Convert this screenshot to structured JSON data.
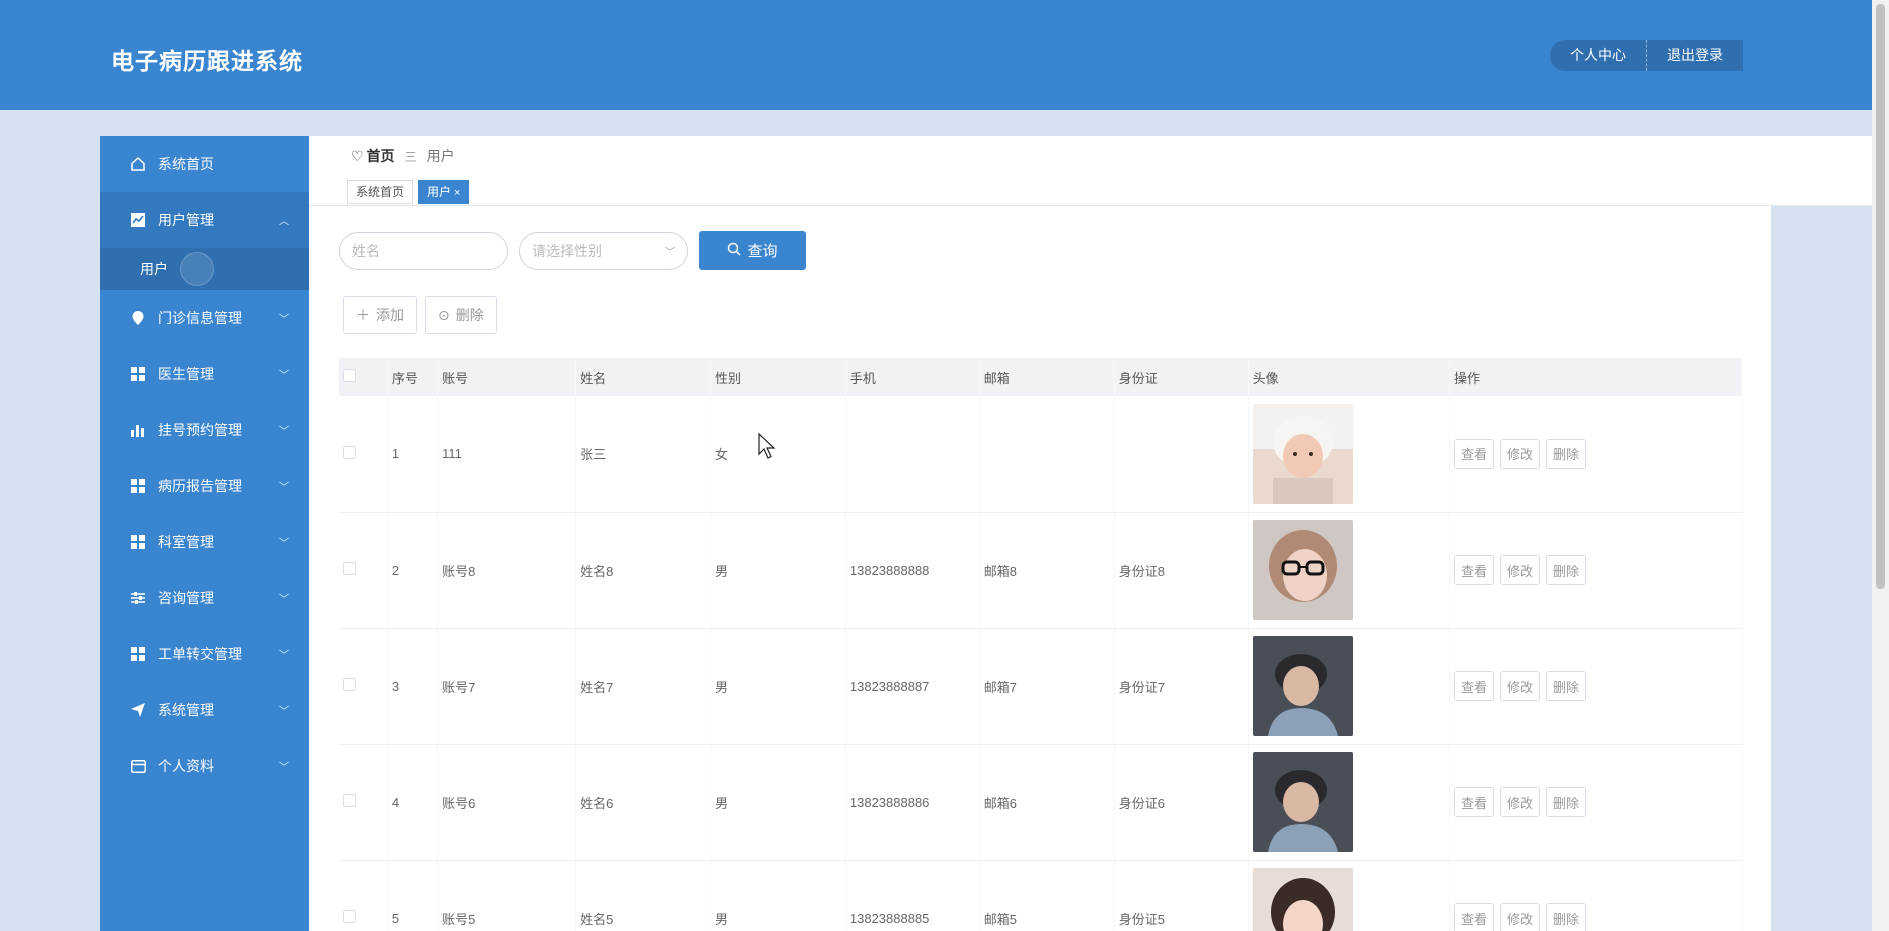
{
  "header": {
    "title": "电子病历跟进系统",
    "personal_center": "个人中心",
    "logout": "退出登录"
  },
  "sidebar": {
    "items": [
      {
        "label": "系统首页",
        "icon": "home-icon"
      },
      {
        "label": "用户管理",
        "icon": "chart-icon",
        "expanded": true,
        "children": [
          {
            "label": "用户"
          }
        ]
      },
      {
        "label": "门诊信息管理",
        "icon": "pin-icon"
      },
      {
        "label": "医生管理",
        "icon": "grid-icon"
      },
      {
        "label": "挂号预约管理",
        "icon": "bar-icon"
      },
      {
        "label": "病历报告管理",
        "icon": "grid-icon"
      },
      {
        "label": "科室管理",
        "icon": "grid-icon"
      },
      {
        "label": "咨询管理",
        "icon": "sliders-icon"
      },
      {
        "label": "工单转交管理",
        "icon": "grid-icon"
      },
      {
        "label": "系统管理",
        "icon": "send-icon"
      },
      {
        "label": "个人资料",
        "icon": "card-icon"
      }
    ]
  },
  "breadcrumb": {
    "home": "首页",
    "separator": "三",
    "current": "用户"
  },
  "tags": [
    {
      "label": "系统首页",
      "active": false
    },
    {
      "label": "用户",
      "active": true,
      "close": "×"
    }
  ],
  "search": {
    "name_placeholder": "姓名",
    "gender_placeholder": "请选择性别",
    "query_label": "查询"
  },
  "actions": {
    "add_label": "添加",
    "delete_label": "删除"
  },
  "table": {
    "columns": [
      "",
      "序号",
      "账号",
      "姓名",
      "性别",
      "手机",
      "邮箱",
      "身份证",
      "头像",
      "操作"
    ],
    "rows": [
      {
        "index": "1",
        "account": "111",
        "name": "张三",
        "gender": "女",
        "phone": "",
        "email": "",
        "id_card": "",
        "avatar": "avatar-1"
      },
      {
        "index": "2",
        "account": "账号8",
        "name": "姓名8",
        "gender": "男",
        "phone": "13823888888",
        "email": "邮箱8",
        "id_card": "身份证8",
        "avatar": "avatar-2"
      },
      {
        "index": "3",
        "account": "账号7",
        "name": "姓名7",
        "gender": "男",
        "phone": "13823888887",
        "email": "邮箱7",
        "id_card": "身份证7",
        "avatar": "avatar-3"
      },
      {
        "index": "4",
        "account": "账号6",
        "name": "姓名6",
        "gender": "男",
        "phone": "13823888886",
        "email": "邮箱6",
        "id_card": "身份证6",
        "avatar": "avatar-4"
      },
      {
        "index": "5",
        "account": "账号5",
        "name": "姓名5",
        "gender": "男",
        "phone": "13823888885",
        "email": "邮箱5",
        "id_card": "身份证5",
        "avatar": "avatar-5"
      }
    ],
    "op_labels": {
      "view": "查看",
      "edit": "修改",
      "delete": "删除"
    }
  },
  "colors": {
    "primary": "#3a85cf",
    "background": "#d6e2f0"
  }
}
